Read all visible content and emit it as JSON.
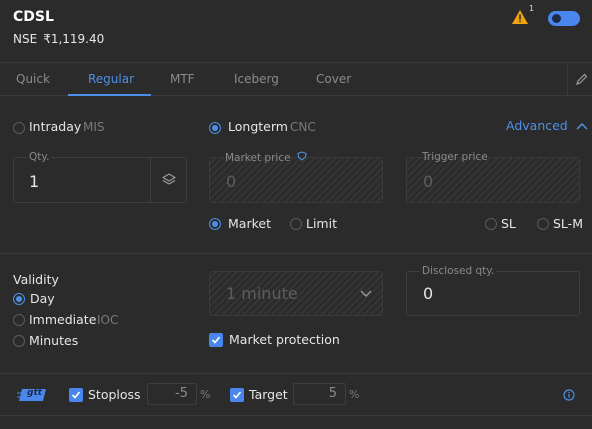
{
  "header": {
    "symbol": "CDSL",
    "exchange": "NSE",
    "price": "₹1,119.40",
    "alert_count": "1",
    "icons": {
      "warning": "warning-icon",
      "toggle": "buy-sell-toggle"
    },
    "colors": {
      "accent": "#4d8fe8",
      "warning": "#f0a30a"
    }
  },
  "tabs": [
    {
      "label": "Quick",
      "active": false
    },
    {
      "label": "Regular",
      "active": true
    },
    {
      "label": "MTF",
      "active": false
    },
    {
      "label": "Iceberg",
      "active": false
    },
    {
      "label": "Cover",
      "active": false
    }
  ],
  "product": {
    "intraday_label": "Intraday",
    "intraday_code": "MIS",
    "longterm_label": "Longterm",
    "longterm_code": "CNC",
    "selected": "Longterm"
  },
  "advanced_label": "Advanced",
  "qty": {
    "label": "Qty.",
    "value": "1"
  },
  "market_price": {
    "label": "Market price",
    "value": "0"
  },
  "trigger_price": {
    "label": "Trigger price",
    "value": "0"
  },
  "order_type": {
    "options": [
      "Market",
      "Limit",
      "SL",
      "SL-M"
    ],
    "selected": "Market"
  },
  "validity": {
    "label": "Validity",
    "options": [
      {
        "label": "Day",
        "selected": true
      },
      {
        "label": "Immediate",
        "code": "IOC",
        "selected": false
      },
      {
        "label": "Minutes",
        "selected": false
      }
    ],
    "minutes_value": "1 minute"
  },
  "disclosed_qty": {
    "label": "Disclosed qty.",
    "value": "0"
  },
  "market_protection": {
    "label": "Market protection",
    "checked": true
  },
  "gtt": {
    "badge": "gtt",
    "stoploss_label": "Stoploss",
    "stoploss_value": "-5",
    "target_label": "Target",
    "target_value": "5",
    "percent": "%"
  }
}
